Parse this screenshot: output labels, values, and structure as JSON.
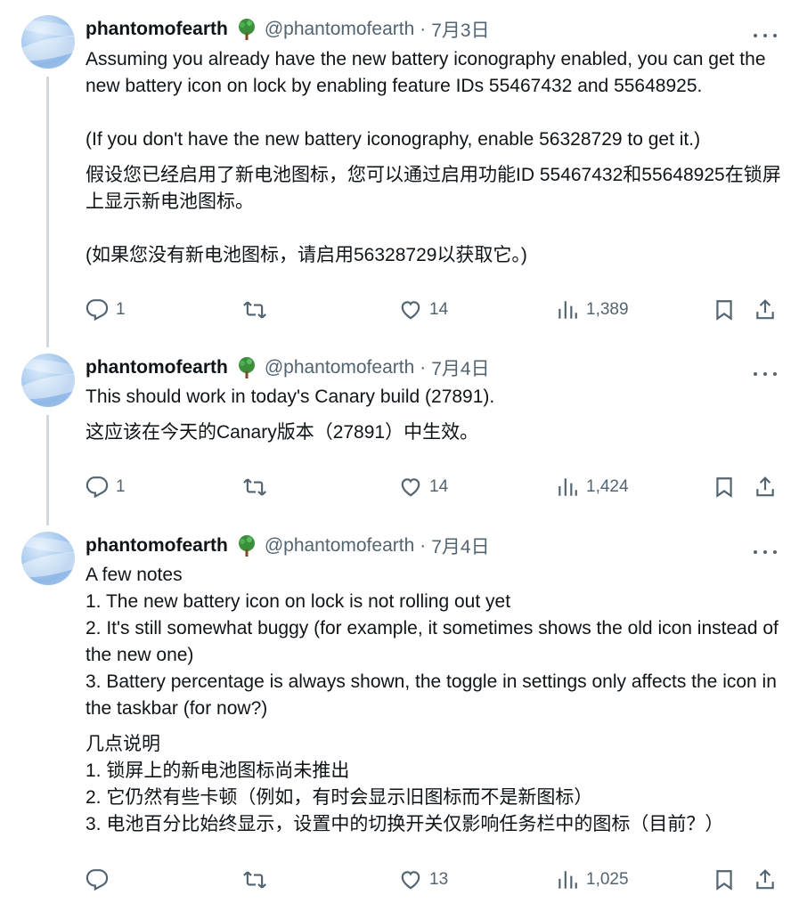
{
  "tweets": [
    {
      "name": "phantomofearth",
      "handle": "@phantomofearth",
      "separator": "·",
      "date": "7月3日",
      "text_en_1": "Assuming you already have the new battery iconography enabled, you can get the new battery icon on lock by enabling feature IDs 55467432 and 55648925.",
      "text_en_2": "(If you don't have the new battery iconography, enable 56328729 to get it.)",
      "text_zh_1": "假设您已经启用了新电池图标，您可以通过启用功能ID 55467432和55648925在锁屏上显示新电池图标。",
      "text_zh_2": "(如果您没有新电池图标，请启用56328729以获取它。)",
      "replies": "1",
      "reposts": "",
      "likes": "14",
      "views": "1,389"
    },
    {
      "name": "phantomofearth",
      "handle": "@phantomofearth",
      "separator": "·",
      "date": "7月4日",
      "text_en_1": "This should work in today's Canary build (27891).",
      "text_zh_1": "这应该在今天的Canary版本（27891）中生效。",
      "replies": "1",
      "reposts": "",
      "likes": "14",
      "views": "1,424"
    },
    {
      "name": "phantomofearth",
      "handle": "@phantomofearth",
      "separator": "·",
      "date": "7月4日",
      "text_en_1": "A few notes\n1. The new battery icon on lock is not rolling out yet\n2. It's still somewhat buggy (for example, it sometimes shows the old icon instead of the new one)\n3. Battery percentage is always shown, the toggle in settings only affects the icon in the taskbar (for now?)",
      "text_zh_1": "几点说明\n1. 锁屏上的新电池图标尚未推出\n2. 它仍然有些卡顿（例如，有时会显示旧图标而不是新图标）\n3. 电池百分比始终显示，设置中的切换开关仅影响任务栏中的图标（目前？）",
      "replies": "",
      "reposts": "",
      "likes": "13",
      "views": "1,025"
    }
  ],
  "icons": {
    "name_badge": "tree-emoji-icon",
    "reply": "reply-icon",
    "repost": "repost-icon",
    "like": "heart-icon",
    "views": "views-bar-chart-icon",
    "bookmark": "bookmark-icon",
    "share": "share-icon",
    "more": "more-dots-icon"
  },
  "colors": {
    "text_primary": "#0f1419",
    "text_secondary": "#536471",
    "thread_line": "#cfd9de",
    "tree_green": "#2e7d32"
  }
}
